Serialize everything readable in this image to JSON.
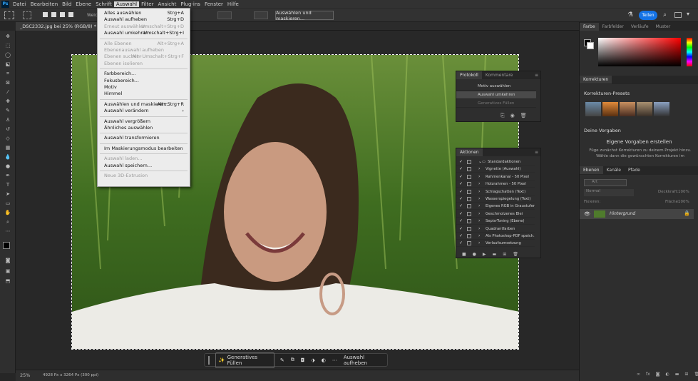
{
  "menubar": {
    "logo": "Ps",
    "items": [
      "Datei",
      "Bearbeiten",
      "Bild",
      "Ebene",
      "Schrift",
      "Auswahl",
      "Filter",
      "Ansicht",
      "Plug-ins",
      "Fenster",
      "Hilfe"
    ],
    "active_index": 5
  },
  "options_bar": {
    "auswahl_maskieren_label": "Auswählen und maskieren...",
    "teilen_label": "Teilen",
    "weich_label": "Weich"
  },
  "document": {
    "tab_title": "_DSC2332.jpg bei 25% (RGB/8) *"
  },
  "status": {
    "zoom": "25%",
    "info": "4928 Px x 3264 Px (300 ppi)"
  },
  "auswahl_menu": {
    "groups": [
      [
        {
          "label": "Alles auswählen",
          "shortcut": "Strg+A",
          "disabled": false
        },
        {
          "label": "Auswahl aufheben",
          "shortcut": "Strg+D",
          "disabled": false
        },
        {
          "label": "Erneut auswählen",
          "shortcut": "Umschalt+Strg+D",
          "disabled": true
        },
        {
          "label": "Auswahl umkehren",
          "shortcut": "Umschalt+Strg+I",
          "disabled": false
        }
      ],
      [
        {
          "label": "Alle Ebenen",
          "shortcut": "Alt+Strg+A",
          "disabled": true
        },
        {
          "label": "Ebenenauswahl aufheben",
          "shortcut": "",
          "disabled": true
        },
        {
          "label": "Ebenen suchen",
          "shortcut": "Alt+Umschalt+Strg+F",
          "disabled": true
        },
        {
          "label": "Ebenen isolieren",
          "shortcut": "",
          "disabled": true
        }
      ],
      [
        {
          "label": "Farbbereich...",
          "shortcut": "",
          "disabled": false
        },
        {
          "label": "Fokusbereich...",
          "shortcut": "",
          "disabled": false
        },
        {
          "label": "Motiv",
          "shortcut": "",
          "disabled": false
        },
        {
          "label": "Himmel",
          "shortcut": "",
          "disabled": false
        }
      ],
      [
        {
          "label": "Auswählen und maskieren...",
          "shortcut": "Alt+Strg+R",
          "disabled": false
        },
        {
          "label": "Auswahl verändern",
          "shortcut": "›",
          "disabled": false
        }
      ],
      [
        {
          "label": "Auswahl vergrößern",
          "shortcut": "",
          "disabled": false
        },
        {
          "label": "Ähnliches auswählen",
          "shortcut": "",
          "disabled": false
        }
      ],
      [
        {
          "label": "Auswahl transformieren",
          "shortcut": "",
          "disabled": false
        }
      ],
      [
        {
          "label": "Im Maskierungsmodus bearbeiten",
          "shortcut": "",
          "disabled": false
        }
      ],
      [
        {
          "label": "Auswahl laden...",
          "shortcut": "",
          "disabled": true
        },
        {
          "label": "Auswahl speichern...",
          "shortcut": "",
          "disabled": false
        }
      ],
      [
        {
          "label": "Neue 3D-Extrusion",
          "shortcut": "",
          "disabled": true
        }
      ]
    ]
  },
  "protokoll": {
    "tabs": [
      "Protokoll",
      "Kommentare"
    ],
    "rows": [
      {
        "label": "Motiv auswählen",
        "state": "normal"
      },
      {
        "label": "Auswahl umkehren",
        "state": "selected"
      },
      {
        "label": "Generatives Füllen",
        "state": "dimmed"
      }
    ]
  },
  "aktionen": {
    "title": "Aktionen",
    "rows": [
      {
        "label": "Standardaktionen",
        "folder": true
      },
      {
        "label": "Vignette (Auswahl)"
      },
      {
        "label": "Rahmenkanal - 50 Pixel"
      },
      {
        "label": "Holzrahmen - 50 Pixel"
      },
      {
        "label": "Schlagschatten (Text)"
      },
      {
        "label": "Wasserspiegelung (Text)"
      },
      {
        "label": "Eigenes RGB in Graustufen"
      },
      {
        "label": "Geschmolzenes Blei"
      },
      {
        "label": "Sepia-Toning (Ebene)"
      },
      {
        "label": "Quadrantfarben"
      },
      {
        "label": "Als Photoshop-PDF speich..."
      },
      {
        "label": "Verlaufsumsetzung"
      }
    ]
  },
  "right_panels": {
    "color_tabs": [
      "Farbe",
      "Farbfelder",
      "Verläufe",
      "Muster"
    ],
    "korrekturen_title": "Korrekturen",
    "presets_label": "Korrekturen-Presets",
    "deine_vorgaben_label": "Deine Vorgaben",
    "eigene_title": "Eigene Vorgaben erstellen",
    "eigene_text": "Füge zunächst Korrekturen zu deinem Projekt hinzu. Wähle dann die gewünschten Korrekturen im",
    "layer_tabs": [
      "Ebenen",
      "Kanäle",
      "Pfade"
    ],
    "search_placeholder": "Art",
    "blend_mode": "Normal",
    "deckkraft_label": "Deckkraft:",
    "deckkraft_value": "100%",
    "fixieren_label": "Fixieren:",
    "flaeche_label": "Fläche:",
    "flaeche_value": "100%",
    "layer_name": "Hintergrund"
  },
  "context_bar": {
    "gen_fill_label": "Generatives Füllen",
    "deselect_label": "Auswahl aufheben"
  },
  "colors": {
    "accent": "#1473e6",
    "selection_highlight": "#d8d8d8"
  }
}
